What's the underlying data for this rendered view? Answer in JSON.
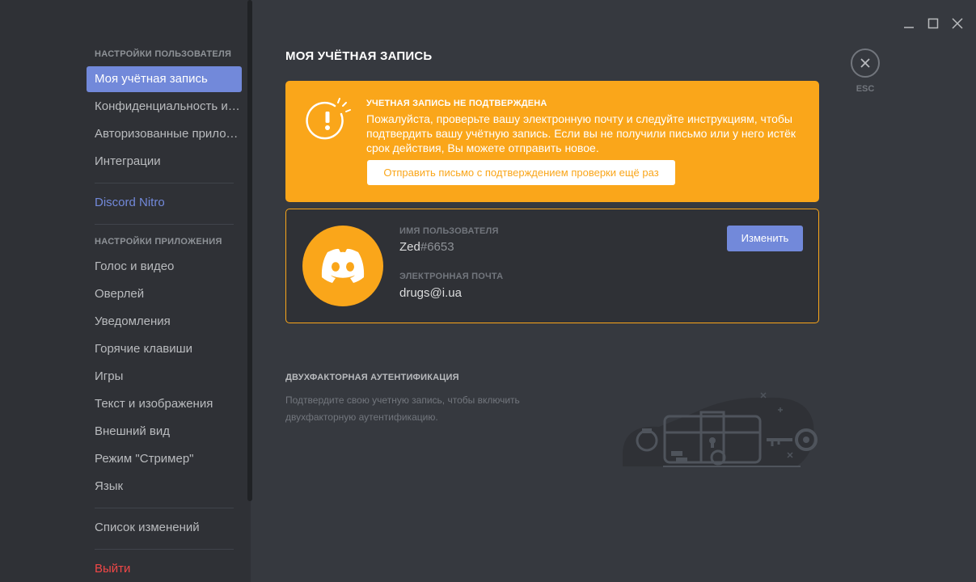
{
  "sidebar": {
    "user_settings_header": "НАСТРОЙКИ ПОЛЬЗОВАТЕЛЯ",
    "user_items": [
      {
        "label": "Моя учётная запись"
      },
      {
        "label": "Конфиденциальность и безопасность"
      },
      {
        "label": "Авторизованные приложения"
      },
      {
        "label": "Интеграции"
      }
    ],
    "nitro": "Discord Nitro",
    "app_settings_header": "НАСТРОЙКИ ПРИЛОЖЕНИЯ",
    "app_items": [
      {
        "label": "Голос и видео"
      },
      {
        "label": "Оверлей"
      },
      {
        "label": "Уведомления"
      },
      {
        "label": "Горячие клавиши"
      },
      {
        "label": "Игры"
      },
      {
        "label": "Текст и изображения"
      },
      {
        "label": "Внешний вид"
      },
      {
        "label": "Режим \"Стример\""
      },
      {
        "label": "Язык"
      }
    ],
    "changelog": "Список изменений",
    "logout": "Выйти"
  },
  "main": {
    "title": "МОЯ УЧЁТНАЯ ЗАПИСЬ",
    "esc_label": "ESC",
    "warning": {
      "title": "УЧЕТНАЯ ЗАПИСЬ НЕ ПОДТВЕРЖДЕНА",
      "text": "Пожалуйста, проверьте вашу электронную почту и следуйте инструкциям, чтобы подтвердить вашу учётную запись. Если вы не получили письмо или у него истёк срок действия, Вы можете отправить новое.",
      "button": "Отправить письмо с подтверждением проверки ещё раз"
    },
    "account": {
      "username_label": "ИМЯ ПОЛЬЗОВАТЕЛЯ",
      "username": "Zed",
      "discriminator": "#6653",
      "email_label": "ЭЛЕКТРОННАЯ ПОЧТА",
      "email": "drugs@i.ua",
      "edit_button": "Изменить"
    },
    "tfa": {
      "title": "ДВУХФАКТОРНАЯ АУТЕНТИФИКАЦИЯ",
      "description": "Подтвердите свою учетную запись, чтобы включить двухфакторную аутентификацию."
    }
  },
  "colors": {
    "accent": "#7289da",
    "warning": "#faa61a",
    "danger": "#f04747",
    "background": "#36393f",
    "sidebar": "#2f3136"
  },
  "icons": [
    "minimize-icon",
    "maximize-icon",
    "close-icon",
    "warning-icon",
    "discord-logo-icon",
    "treasure-chest-illustration"
  ]
}
